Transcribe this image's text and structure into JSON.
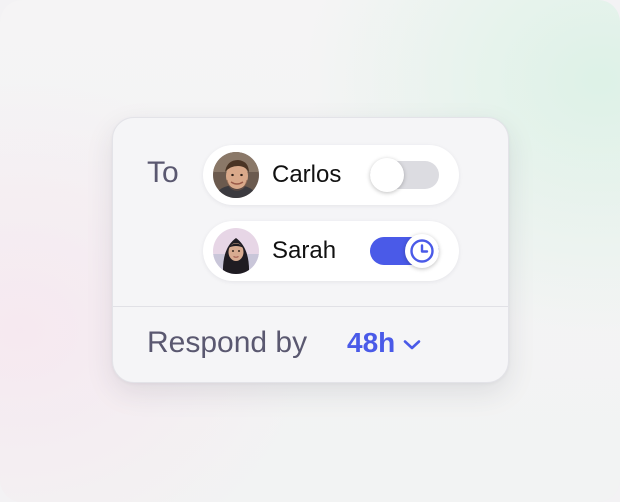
{
  "to_label": "To",
  "recipients": [
    {
      "name": "Carlos",
      "enabled": false,
      "avatar_icon": "carlos-avatar"
    },
    {
      "name": "Sarah",
      "enabled": true,
      "avatar_icon": "sarah-avatar",
      "knob_icon": "clock-icon"
    }
  ],
  "respond_by": {
    "label": "Respond by",
    "value": "48h",
    "dropdown_icon": "chevron-down-icon"
  },
  "colors": {
    "accent": "#4a5ae8",
    "label_text": "#5a5870",
    "toggle_off": "#dcdce1"
  }
}
